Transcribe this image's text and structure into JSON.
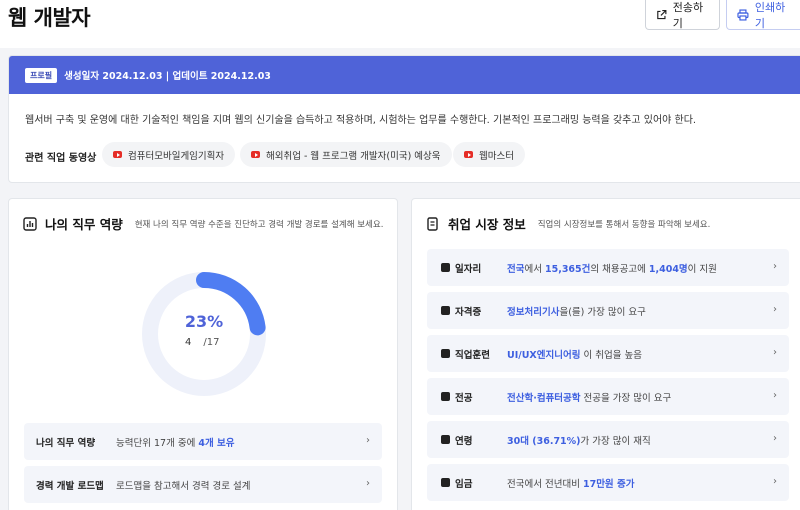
{
  "header": {
    "title": "웹 개발자",
    "send_label": "전송하기",
    "print_label": "인쇄하기"
  },
  "profile": {
    "badge": "프로필",
    "dates": "생성일자 2024.12.03 | 업데이트 2024.12.03",
    "description": "웹서버 구축 및 운영에 대한 기술적인 책임을 지며 웹의 신기술을 습득하고 적용하며, 시험하는 업무를 수행한다. 기본적인 프로그래밍 능력을 갖추고 있어야 한다.",
    "videos_label": "관련 직업 동영상",
    "videos": [
      {
        "label": "컴퓨터모바일게임기획자"
      },
      {
        "label": "해외취업 - 웹 프로그램 개발자(미국) 예상욱"
      },
      {
        "label": "웹마스터"
      }
    ]
  },
  "competency": {
    "title": "나의 직무 역량",
    "subtitle": "현재 나의 직무 역량 수준을 진단하고 경력 개발 경로를 설계해 보세요.",
    "percent": 23,
    "percent_text": "23%",
    "owned": "4",
    "total": "/17",
    "rows": [
      {
        "label": "나의 직무 역량",
        "text_before": "능력단위 17개 중에 ",
        "highlight": "4개 보유",
        "text_after": ""
      },
      {
        "label": "경력 개발 로드맵",
        "text_before": "로드맵을 참고해서 경력 경로 설계",
        "highlight": "",
        "text_after": ""
      }
    ]
  },
  "market": {
    "title": "취업 시장 정보",
    "subtitle": "직업의 시장정보를 통해서 동향을 파악해 보세요.",
    "rows": [
      {
        "label": "일자리",
        "icon": "briefcase-icon",
        "parts": [
          {
            "t": "전국",
            "h": true
          },
          {
            "t": "에서 ",
            "h": false
          },
          {
            "t": "15,365건",
            "h": true
          },
          {
            "t": "의 채용공고에 ",
            "h": false
          },
          {
            "t": "1,404명",
            "h": true
          },
          {
            "t": "이 지원",
            "h": false
          }
        ]
      },
      {
        "label": "자격증",
        "icon": "award-icon",
        "parts": [
          {
            "t": "정보처리기사",
            "h": true
          },
          {
            "t": "을(를) 가장 많이 요구",
            "h": false
          }
        ]
      },
      {
        "label": "직업훈련",
        "icon": "pencil-icon",
        "parts": [
          {
            "t": "UI/UX엔지니어링",
            "h": true
          },
          {
            "t": " 이 취업을 높음",
            "h": false
          }
        ]
      },
      {
        "label": "전공",
        "icon": "book-icon",
        "parts": [
          {
            "t": "전산학·컴퓨터공학",
            "h": true
          },
          {
            "t": " 전공을 가장 많이 요구",
            "h": false
          }
        ]
      },
      {
        "label": "연령",
        "icon": "person-icon",
        "parts": [
          {
            "t": "30대 (36.71%)",
            "h": true
          },
          {
            "t": "가 가장 많이 재직",
            "h": false
          }
        ]
      },
      {
        "label": "임금",
        "icon": "won-icon",
        "parts": [
          {
            "t": "전국에서 전년대비 ",
            "h": false
          },
          {
            "t": "17만원 증가",
            "h": true
          }
        ]
      }
    ]
  },
  "colors": {
    "accent": "#4f63d8",
    "highlight": "#3d5fe0",
    "video": "#e52d27"
  }
}
